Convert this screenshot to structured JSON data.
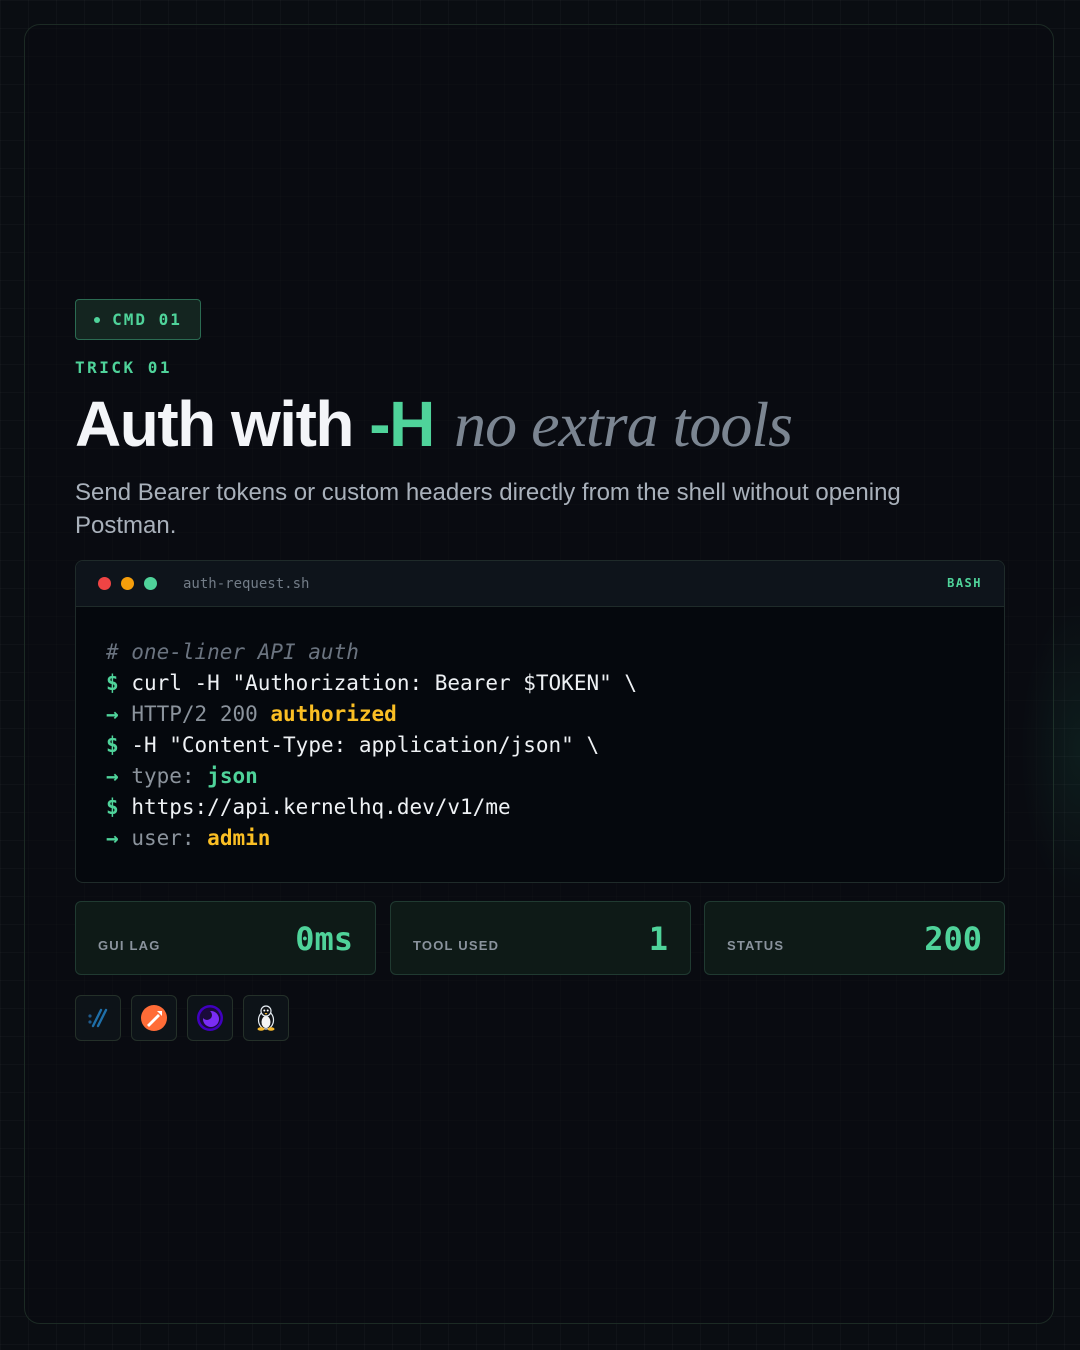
{
  "badge": {
    "label": "CMD 01"
  },
  "eyebrow": "TRICK 01",
  "title": {
    "main": "Auth with ",
    "flag": "-H",
    "italic": "no extra tools"
  },
  "subtitle": "Send Bearer tokens or custom headers directly from the shell without opening Postman.",
  "terminal": {
    "filename": "auth-request.sh",
    "language": "BASH",
    "lights": [
      "#ef4444",
      "#f59e0b",
      "#4fd39a"
    ],
    "lines": {
      "comment": "# one-liner API auth",
      "cmd1_prompt": "$",
      "cmd1_text": "curl -H \"Authorization: Bearer $TOKEN\" \\",
      "out1_arrow": "→",
      "out1_text": "HTTP/2 200 ",
      "out1_value": "authorized",
      "cmd2_prompt": "$",
      "cmd2_text": "-H \"Content-Type: application/json\" \\",
      "out2_arrow": "→",
      "out2_text": "type: ",
      "out2_value": "json",
      "cmd3_prompt": "$",
      "cmd3_text": "https://api.kernelhq.dev/v1/me",
      "out3_arrow": "→",
      "out3_text": "user: ",
      "out3_value": "admin"
    }
  },
  "stats": [
    {
      "label": "GUI LAG",
      "value": "0ms"
    },
    {
      "label": "TOOL USED",
      "value": "1"
    },
    {
      "label": "STATUS",
      "value": "200"
    }
  ],
  "tools": [
    {
      "icon": "curl-icon"
    },
    {
      "icon": "postman-icon"
    },
    {
      "icon": "insomnia-icon"
    },
    {
      "icon": "linux-tux-icon"
    }
  ],
  "colors": {
    "accent": "#4fd39a",
    "amber": "#fbbf24",
    "background": "#0a0d12"
  }
}
